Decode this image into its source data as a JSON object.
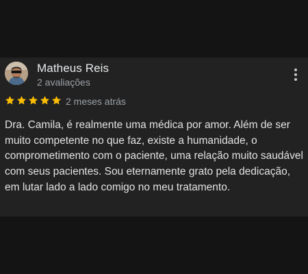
{
  "review": {
    "author_name": "Matheus Reis",
    "author_reviews": "2 avaliações",
    "rating": 5,
    "rating_max": 5,
    "date": "2 meses atrás",
    "text": "Dra. Camila, é realmente uma médica por amor. Além de ser muito competente no que faz, existe a humanidade, o comprometimento com o paciente, uma relação muito saudável com seus pacientes. Sou eternamente grato pela dedicação, em lutar lado a lado comigo no meu tratamento.",
    "star_color": "#fbbc04",
    "more_icon": "more-vert-icon"
  }
}
